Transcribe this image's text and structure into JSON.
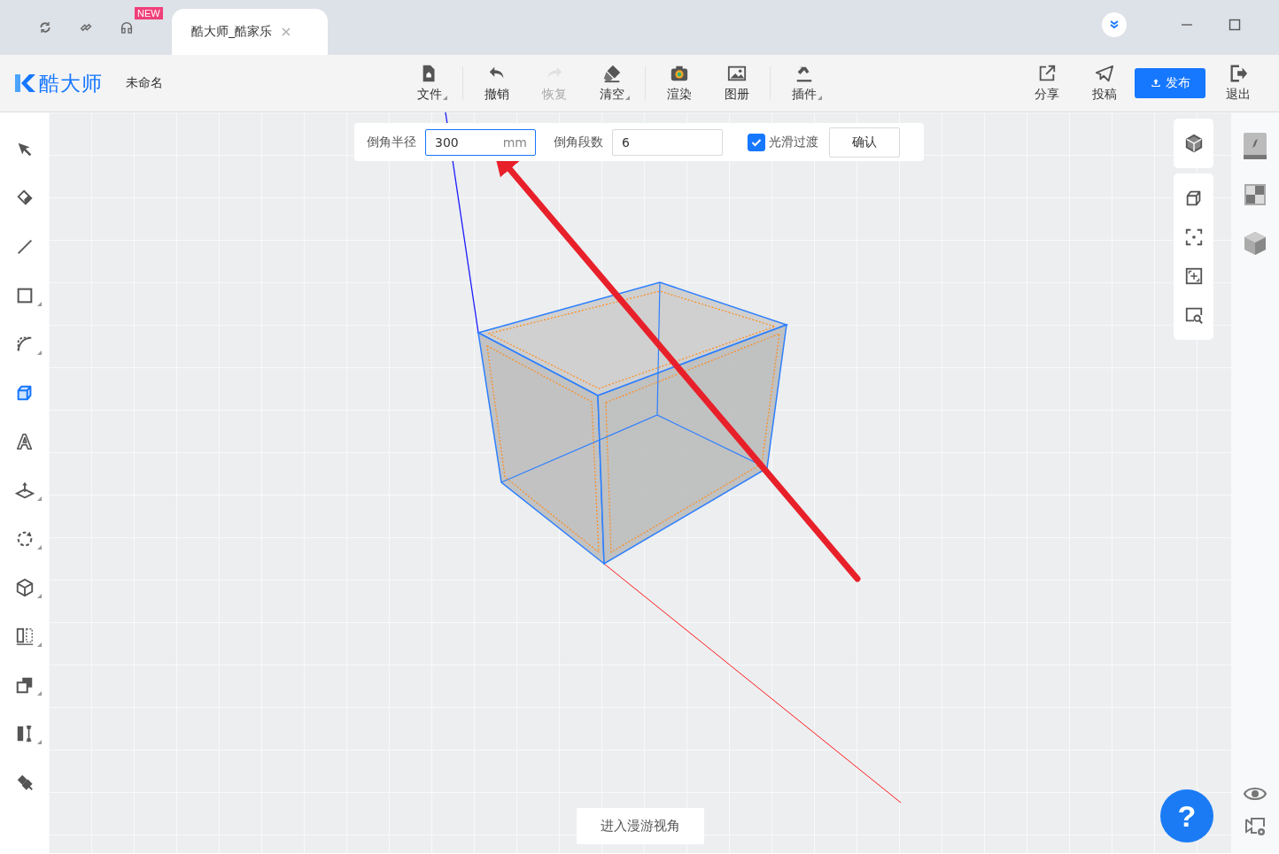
{
  "title_bar": {
    "new_badge": "NEW",
    "tabs": [
      {
        "label": "酷大师_酷家乐",
        "selected": true
      }
    ]
  },
  "toolbar": {
    "logo": "酷大师",
    "document_name": "未命名",
    "tools": [
      {
        "label": "文件",
        "submenu": true,
        "disabled": false
      },
      {
        "label": "撤销",
        "submenu": false,
        "disabled": false
      },
      {
        "label": "恢复",
        "submenu": false,
        "disabled": true
      },
      {
        "label": "清空",
        "submenu": true,
        "disabled": false
      },
      {
        "label": "渲染",
        "submenu": false,
        "disabled": false
      },
      {
        "label": "图册",
        "submenu": false,
        "disabled": false
      },
      {
        "label": "插件",
        "submenu": true,
        "disabled": false
      }
    ],
    "actions": [
      {
        "label": "分享",
        "kind": "plain"
      },
      {
        "label": "投稿",
        "kind": "plain"
      },
      {
        "label": "发布",
        "kind": "primary"
      },
      {
        "label": "退出",
        "kind": "plain"
      }
    ]
  },
  "left_tools": [
    {
      "selected": false,
      "submenu": false
    },
    {
      "selected": false,
      "submenu": false
    },
    {
      "selected": false,
      "submenu": false
    },
    {
      "selected": false,
      "submenu": true
    },
    {
      "selected": false,
      "submenu": true
    },
    {
      "selected": true,
      "submenu": false
    },
    {
      "selected": false,
      "submenu": false
    },
    {
      "selected": false,
      "submenu": true
    },
    {
      "selected": false,
      "submenu": true
    },
    {
      "selected": false,
      "submenu": true
    },
    {
      "selected": false,
      "submenu": true
    },
    {
      "selected": false,
      "submenu": true
    },
    {
      "selected": false,
      "submenu": true
    },
    {
      "selected": false,
      "submenu": false
    }
  ],
  "chamfer_panel": {
    "radius_label": "倒角半径",
    "radius_value": "300",
    "radius_unit": "mm",
    "segments_label": "倒角段数",
    "segments_value": "6",
    "smooth": {
      "label": "光滑过渡",
      "checked": true
    },
    "confirm": "确认"
  },
  "roam_button": "进入漫游视角",
  "help": "?"
}
